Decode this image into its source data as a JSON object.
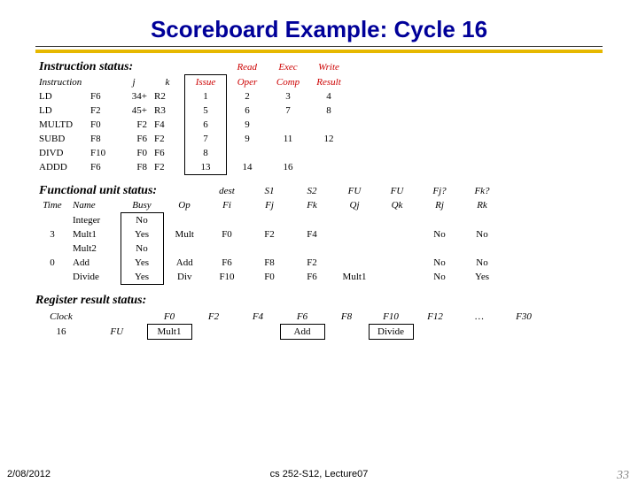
{
  "title": "Scoreboard Example: Cycle 16",
  "sections": {
    "instr": "Instruction status:",
    "fu": "Functional unit status:",
    "reg": "Register result status:"
  },
  "instr_headers": {
    "top": {
      "issue": "Issue",
      "read": "Read",
      "exec": "Exec",
      "write": "Write"
    },
    "sub": {
      "oper": "Oper",
      "comp": "Comp",
      "result": "Result"
    },
    "instr": "Instruction",
    "j": "j",
    "k": "k"
  },
  "instructions": [
    {
      "op": "LD",
      "dst": "F6",
      "j": "34+",
      "k": "R2",
      "issue": "1",
      "read": "2",
      "exec": "3",
      "write": "4"
    },
    {
      "op": "LD",
      "dst": "F2",
      "j": "45+",
      "k": "R3",
      "issue": "5",
      "read": "6",
      "exec": "7",
      "write": "8"
    },
    {
      "op": "MULTD",
      "dst": "F0",
      "j": "F2",
      "k": "F4",
      "issue": "6",
      "read": "9",
      "exec": "",
      "write": ""
    },
    {
      "op": "SUBD",
      "dst": "F8",
      "j": "F6",
      "k": "F2",
      "issue": "7",
      "read": "9",
      "exec": "11",
      "write": "12"
    },
    {
      "op": "DIVD",
      "dst": "F10",
      "j": "F0",
      "k": "F6",
      "issue": "8",
      "read": "",
      "exec": "",
      "write": ""
    },
    {
      "op": "ADDD",
      "dst": "F6",
      "j": "F8",
      "k": "F2",
      "issue": "13",
      "read": "14",
      "exec": "16",
      "write": ""
    }
  ],
  "fu_headers": {
    "top": {
      "dest": "dest",
      "s1": "S1",
      "s2": "S2",
      "fu_j": "FU",
      "fu_k": "FU",
      "fjq": "Fj?",
      "fkq": "Fk?"
    },
    "row": {
      "time": "Time",
      "name": "Name",
      "busy": "Busy",
      "op": "Op",
      "fi": "Fi",
      "fj": "Fj",
      "fk": "Fk",
      "qj": "Qj",
      "qk": "Qk",
      "rj": "Rj",
      "rk": "Rk"
    }
  },
  "fu_rows": [
    {
      "time": "",
      "name": "Integer",
      "busy": "No",
      "op": "",
      "fi": "",
      "fj": "",
      "fk": "",
      "qj": "",
      "qk": "",
      "rj": "",
      "rk": ""
    },
    {
      "time": "3",
      "name": "Mult1",
      "busy": "Yes",
      "op": "Mult",
      "fi": "F0",
      "fj": "F2",
      "fk": "F4",
      "qj": "",
      "qk": "",
      "rj": "No",
      "rk": "No"
    },
    {
      "time": "",
      "name": "Mult2",
      "busy": "No",
      "op": "",
      "fi": "",
      "fj": "",
      "fk": "",
      "qj": "",
      "qk": "",
      "rj": "",
      "rk": ""
    },
    {
      "time": "0",
      "name": "Add",
      "busy": "Yes",
      "op": "Add",
      "fi": "F6",
      "fj": "F8",
      "fk": "F2",
      "qj": "",
      "qk": "",
      "rj": "No",
      "rk": "No"
    },
    {
      "time": "",
      "name": "Divide",
      "busy": "Yes",
      "op": "Div",
      "fi": "F10",
      "fj": "F0",
      "fk": "F6",
      "qj": "Mult1",
      "qk": "",
      "rj": "No",
      "rk": "Yes"
    }
  ],
  "reg": {
    "clock_label": "Clock",
    "clock": "16",
    "fu_label": "FU",
    "cols": [
      "F0",
      "F2",
      "F4",
      "F6",
      "F8",
      "F10",
      "F12",
      "…",
      "F30"
    ],
    "vals": [
      "Mult1",
      "",
      "",
      "Add",
      "",
      "Divide",
      "",
      "",
      ""
    ]
  },
  "footer": {
    "date": "2/08/2012",
    "mid": "cs 252-S12, Lecture07",
    "page": "33"
  }
}
